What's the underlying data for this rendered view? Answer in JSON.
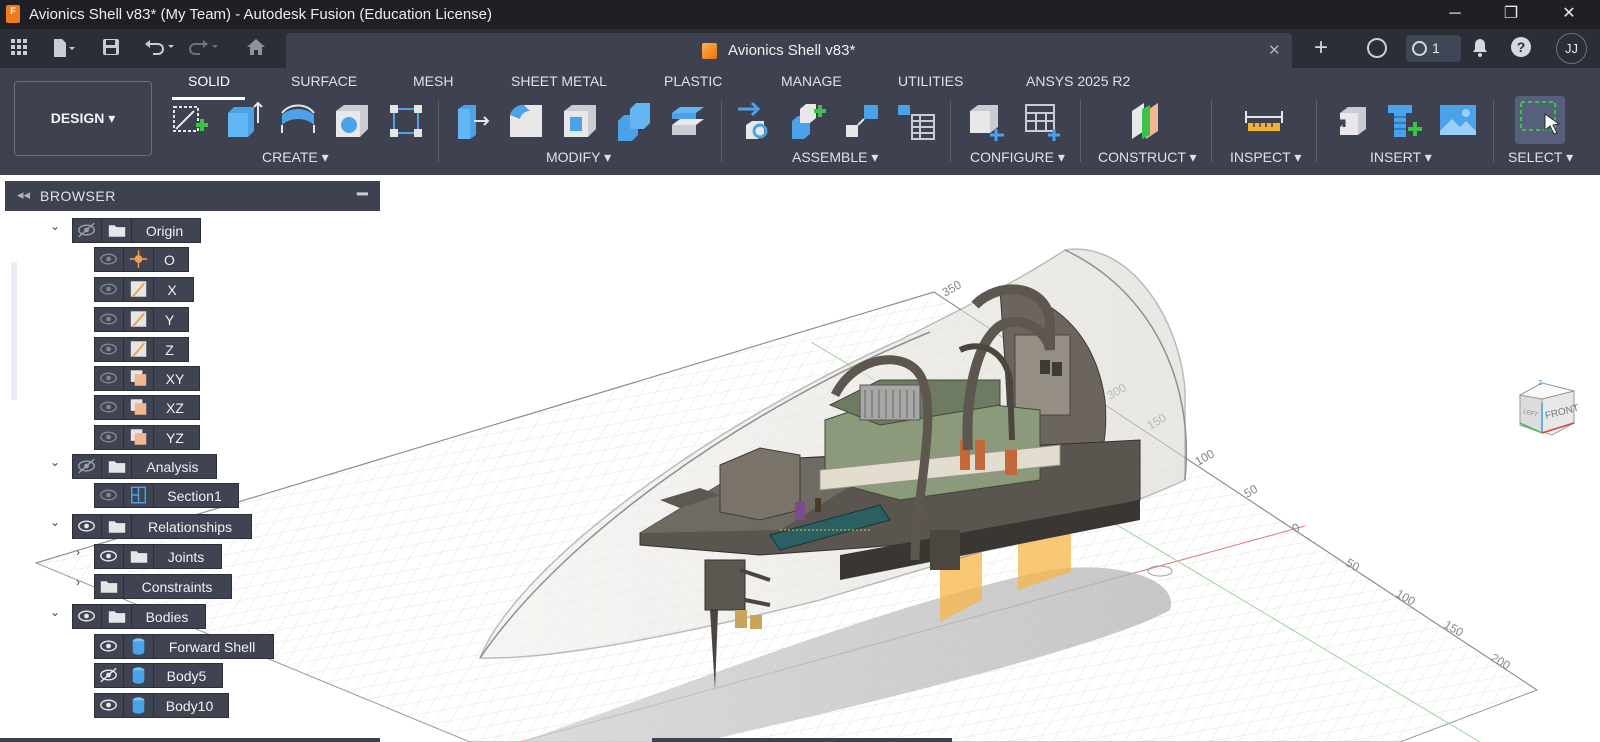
{
  "window": {
    "logo_letter": "F",
    "title": "Avionics Shell v83* (My Team) - Autodesk Fusion (Education License)",
    "minimize": "─",
    "maximize": "❐",
    "close": "✕"
  },
  "document_tab": {
    "title": "Avionics Shell v83*",
    "close": "✕"
  },
  "quick_access": {
    "job_count": "1",
    "avatar_initials": "JJ",
    "help": "?"
  },
  "workspace": {
    "label": "DESIGN ▾"
  },
  "tabs": [
    "SOLID",
    "SURFACE",
    "MESH",
    "SHEET METAL",
    "PLASTIC",
    "MANAGE",
    "UTILITIES",
    "ANSYS 2025 R2"
  ],
  "groups": [
    "CREATE ▾",
    "MODIFY ▾",
    "ASSEMBLE ▾",
    "CONFIGURE ▾",
    "CONSTRUCT ▾",
    "INSPECT ▾",
    "INSERT ▾",
    "SELECT ▾"
  ],
  "browser": {
    "title": "BROWSER",
    "collapse": "◂◂",
    "minimize": "━",
    "nodes": [
      {
        "label": "Origin"
      },
      {
        "label": "O"
      },
      {
        "label": "X"
      },
      {
        "label": "Y"
      },
      {
        "label": "Z"
      },
      {
        "label": "XY"
      },
      {
        "label": "XZ"
      },
      {
        "label": "YZ"
      },
      {
        "label": "Analysis"
      },
      {
        "label": "Section1"
      },
      {
        "label": "Relationships"
      },
      {
        "label": "Joints"
      },
      {
        "label": "Constraints"
      },
      {
        "label": "Bodies"
      },
      {
        "label": "Forward Shell"
      },
      {
        "label": "Body5"
      },
      {
        "label": "Body10"
      }
    ]
  },
  "viewport": {
    "viewcube_face": "FRONT",
    "viewcube_left": "LEFT",
    "viewcube_top": "Z",
    "grid_labels": [
      "350",
      "300",
      "150",
      "100",
      "50",
      "0",
      "50",
      "100",
      "150",
      "200"
    ]
  },
  "colors": {
    "titlebar": "#1e2025",
    "ribbon": "#3d4150",
    "accent": "#f07b1a"
  }
}
